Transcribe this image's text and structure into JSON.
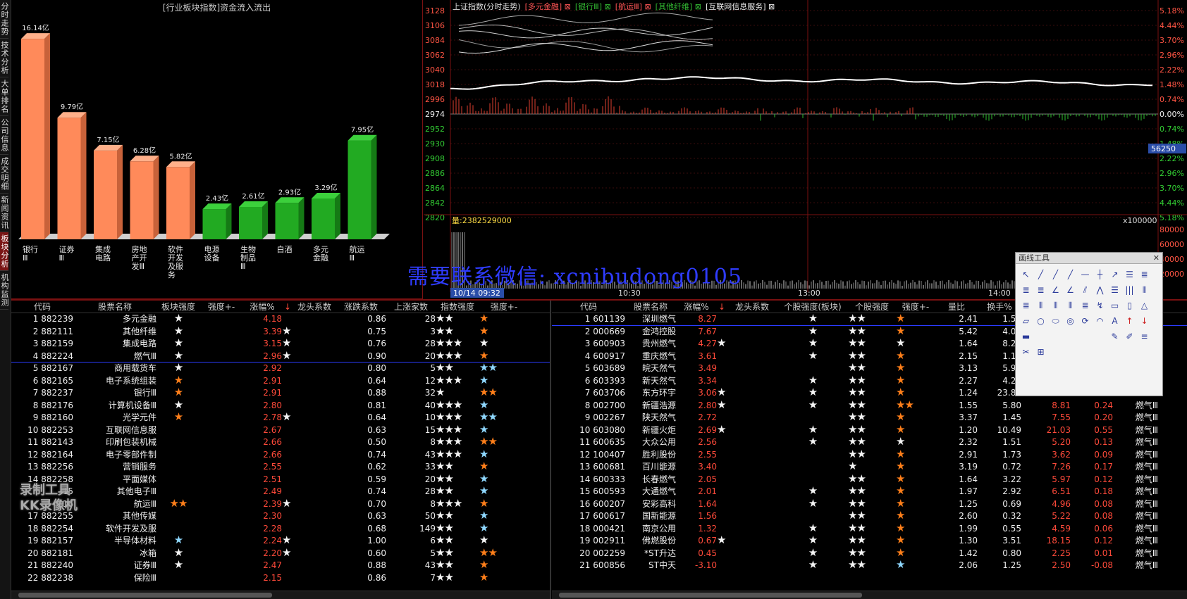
{
  "side_tabs": [
    "分时走势",
    "技术分析",
    "大单排名",
    "公司信息",
    "成交明细",
    "新闻资讯",
    "板块分析",
    "机构监测"
  ],
  "active_side_tab": 6,
  "bar_chart": {
    "title": "[行业板块指数]资金流入流出",
    "chart_data": {
      "type": "bar",
      "title": "[行业板块指数]资金流入流出",
      "categories": [
        "银行Ⅲ",
        "证券Ⅲ",
        "集成电路",
        "房地产开发Ⅲ",
        "软件开发及服务",
        "电源设备",
        "生物制品Ⅲ",
        "白酒",
        "多元金融",
        "航运Ⅲ"
      ],
      "values": [
        16.14,
        9.79,
        7.15,
        6.28,
        5.82,
        2.43,
        2.61,
        2.93,
        3.29,
        7.95
      ],
      "labels": [
        "16.14亿",
        "9.79亿",
        "7.15亿",
        "6.28亿",
        "5.82亿",
        "2.43亿",
        "2.61亿",
        "2.93亿",
        "3.29亿",
        "7.95亿"
      ],
      "colors": [
        "#ff8a5a",
        "#ff8a5a",
        "#ff8a5a",
        "#ff8a5a",
        "#ff8a5a",
        "#22aa22",
        "#22aa22",
        "#22aa22",
        "#22aa22",
        "#22aa22"
      ],
      "category_lines": [
        [
          "银行",
          "Ⅲ"
        ],
        [
          "证券",
          "Ⅲ"
        ],
        [
          "集成",
          "电路"
        ],
        [
          "房地",
          "产开",
          "发Ⅲ"
        ],
        [
          "软件",
          "开发",
          "及服",
          "务"
        ],
        [
          "电源",
          "设备"
        ],
        [
          "生物",
          "制品",
          "Ⅲ"
        ],
        [
          "白酒"
        ],
        [
          "多元",
          "金融"
        ],
        [
          "航运",
          "Ⅲ"
        ]
      ],
      "ylim": [
        0,
        17
      ]
    }
  },
  "intraday": {
    "title": "上证指数(分时走势)",
    "legend": [
      {
        "text": "上证指数(分时走势)",
        "color": "#dddddd"
      },
      {
        "text": "[多元金融] ⊠",
        "color": "#ff5555"
      },
      {
        "text": "[银行Ⅲ] ⊠",
        "color": "#33bb33"
      },
      {
        "text": "[航运Ⅲ] ⊠",
        "color": "#ff5555"
      },
      {
        "text": "[其他纤维] ⊠",
        "color": "#33bb33"
      },
      {
        "text": "[互联网信息服务] ⊠",
        "color": "#eeeeee"
      }
    ],
    "left_axis": [
      "3128",
      "3106",
      "3084",
      "3062",
      "3040",
      "3018",
      "2996",
      "2974",
      "2952",
      "2930",
      "2908",
      "2886",
      "2864",
      "2842",
      "2820"
    ],
    "right_axis": [
      "5.18%",
      "4.44%",
      "3.70%",
      "2.96%",
      "2.22%",
      "1.48%",
      "0.74%",
      "0.00%",
      "0.74%",
      "1.48%",
      "2.22%",
      "2.96%",
      "3.70%",
      "4.44%",
      "5.18%"
    ],
    "volume_label": "量:2382529000",
    "volume_scale": "x100000",
    "volume_axis": [
      "80000",
      "60000",
      "40000",
      "20000"
    ],
    "price_tag": "56250",
    "time_cursor": "10/14 09:32",
    "time_labels": [
      "10:30",
      "13:00",
      "14:00"
    ]
  },
  "watermark": "需要联系微信: xcnibudong0105",
  "left_table": {
    "headers": [
      "代码",
      "股票名称",
      "板块强度",
      "强度+-",
      "涨幅%",
      "↓",
      "龙头系数",
      "涨跌系数",
      "上涨家数",
      "指数强度",
      "强度+-"
    ],
    "rows": [
      {
        "idx": "1",
        "code": "882239",
        "name": "多元金融",
        "strength": "sw1",
        "chg": "4.18",
        "lt": "",
        "dragon": "0.86",
        "up": "28",
        "idx_s": "sw2",
        "pm": "so1"
      },
      {
        "idx": "2",
        "code": "882111",
        "name": "其他纤维",
        "strength": "sw1",
        "chg": "3.39",
        "lt": "sw1",
        "dragon": "0.75",
        "up": "3",
        "idx_s": "sw2",
        "pm": "so1"
      },
      {
        "idx": "3",
        "code": "882159",
        "name": "集成电路",
        "strength": "sw1",
        "chg": "3.15",
        "lt": "sw1",
        "dragon": "0.76",
        "up": "28",
        "idx_s": "sw3",
        "pm": "sw1"
      },
      {
        "idx": "4",
        "code": "882224",
        "name": "燃气Ⅲ",
        "strength": "sw1",
        "chg": "2.96",
        "lt": "sw1",
        "dragon": "0.90",
        "up": "20",
        "idx_s": "sw3",
        "pm": "so1"
      },
      {
        "idx": "5",
        "code": "882167",
        "name": "商用载货车",
        "strength": "sw1",
        "chg": "2.92",
        "lt": "",
        "dragon": "0.80",
        "up": "5",
        "idx_s": "sw2",
        "pm": "sb2"
      },
      {
        "idx": "6",
        "code": "882165",
        "name": "电子系统组装",
        "strength": "so1",
        "chg": "2.91",
        "lt": "",
        "dragon": "0.64",
        "up": "12",
        "idx_s": "sw3",
        "pm": "sb1"
      },
      {
        "idx": "7",
        "code": "882237",
        "name": "银行Ⅲ",
        "strength": "so1",
        "chg": "2.91",
        "lt": "",
        "dragon": "0.88",
        "up": "32",
        "idx_s": "sw1",
        "pm": "so2"
      },
      {
        "idx": "8",
        "code": "882176",
        "name": "计算机设备Ⅲ",
        "strength": "sw1",
        "chg": "2.80",
        "lt": "",
        "dragon": "0.81",
        "up": "40",
        "idx_s": "sw3",
        "pm": "sb1"
      },
      {
        "idx": "9",
        "code": "882160",
        "name": "光学元件",
        "strength": "so1",
        "chg": "2.78",
        "lt": "sw1",
        "dragon": "0.64",
        "up": "10",
        "idx_s": "sw3",
        "pm": "sb2"
      },
      {
        "idx": "10",
        "code": "882253",
        "name": "互联网信息服",
        "strength": "",
        "chg": "2.67",
        "lt": "",
        "dragon": "0.63",
        "up": "15",
        "idx_s": "sw3",
        "pm": "sb1"
      },
      {
        "idx": "11",
        "code": "882143",
        "name": "印刷包装机械",
        "strength": "",
        "chg": "2.66",
        "lt": "",
        "dragon": "0.50",
        "up": "8",
        "idx_s": "sw3",
        "pm": "so2"
      },
      {
        "idx": "12",
        "code": "882164",
        "name": "电子零部件制",
        "strength": "",
        "chg": "2.66",
        "lt": "",
        "dragon": "0.74",
        "up": "43",
        "idx_s": "sw3",
        "pm": "sb1"
      },
      {
        "idx": "13",
        "code": "882256",
        "name": "营销服务",
        "strength": "",
        "chg": "2.55",
        "lt": "",
        "dragon": "0.62",
        "up": "33",
        "idx_s": "sw2",
        "pm": "so1"
      },
      {
        "idx": "14",
        "code": "882258",
        "name": "平面媒体",
        "strength": "",
        "chg": "2.51",
        "lt": "",
        "dragon": "0.59",
        "up": "20",
        "idx_s": "sw2",
        "pm": "sb1"
      },
      {
        "idx": "15",
        "code": "",
        "name": "其他电子Ⅲ",
        "strength": "",
        "chg": "2.49",
        "lt": "",
        "dragon": "0.74",
        "up": "28",
        "idx_s": "sw2",
        "pm": "sb1"
      },
      {
        "idx": "16",
        "code": "",
        "name": "航运Ⅲ",
        "strength": "so2",
        "chg": "2.39",
        "lt": "sw1",
        "dragon": "0.70",
        "up": "8",
        "idx_s": "sw3",
        "pm": "so1"
      },
      {
        "idx": "17",
        "code": "882255",
        "name": "其他传媒",
        "strength": "",
        "chg": "2.30",
        "lt": "",
        "dragon": "0.63",
        "up": "50",
        "idx_s": "sw2",
        "pm": "sb1"
      },
      {
        "idx": "18",
        "code": "882254",
        "name": "软件开发及服",
        "strength": "",
        "chg": "2.28",
        "lt": "",
        "dragon": "0.68",
        "up": "149",
        "idx_s": "sw2",
        "pm": "sb1"
      },
      {
        "idx": "19",
        "code": "882157",
        "name": "半导体材料",
        "strength": "sb1",
        "chg": "2.24",
        "lt": "sw1",
        "dragon": "1.00",
        "up": "6",
        "idx_s": "sw2",
        "pm": "sw1"
      },
      {
        "idx": "20",
        "code": "882181",
        "name": "冰箱",
        "strength": "sw1",
        "chg": "2.20",
        "lt": "sw1",
        "dragon": "0.60",
        "up": "5",
        "idx_s": "sw2",
        "pm": "so2"
      },
      {
        "idx": "21",
        "code": "882240",
        "name": "证券Ⅲ",
        "strength": "sw1",
        "chg": "2.47",
        "lt": "",
        "dragon": "0.88",
        "up": "43",
        "idx_s": "sw2",
        "pm": "so1"
      },
      {
        "idx": "22",
        "code": "882238",
        "name": "保险Ⅲ",
        "strength": "",
        "chg": "2.15",
        "lt": "",
        "dragon": "0.86",
        "up": "7",
        "idx_s": "sw2",
        "pm": "so1"
      }
    ]
  },
  "right_table": {
    "headers": [
      "代码",
      "股票名称",
      "涨幅%",
      "↓",
      "龙头系数",
      "个股强度(板块)",
      "个股强度",
      "强度+-",
      "量比",
      "换手%",
      "最"
    ],
    "rows": [
      {
        "idx": "1",
        "code": "601139",
        "name": "深圳燃气",
        "chg": "8.27",
        "lt": "",
        "s1": "sw1",
        "s2": "sw2",
        "pm": "so1",
        "vr": "2.41",
        "to": "1.55",
        "c3": "",
        "c4": "",
        "c5": ""
      },
      {
        "idx": "2",
        "code": "000669",
        "name": "金鸿控股",
        "chg": "7.67",
        "lt": "",
        "s1": "sw1",
        "s2": "sw2",
        "pm": "so1",
        "vr": "5.42",
        "to": "4.04",
        "c3": "",
        "c4": "",
        "c5": ""
      },
      {
        "idx": "3",
        "code": "600903",
        "name": "贵州燃气",
        "chg": "4.27",
        "lt": "sw1",
        "s1": "sw1",
        "s2": "sw2",
        "pm": "sw1",
        "vr": "1.64",
        "to": "8.22",
        "c3": "",
        "c4": "",
        "c5": ""
      },
      {
        "idx": "4",
        "code": "600917",
        "name": "重庆燃气",
        "chg": "3.61",
        "lt": "",
        "s1": "sw1",
        "s2": "sw2",
        "pm": "so1",
        "vr": "2.15",
        "to": "1.19",
        "c3": "",
        "c4": "",
        "c5": ""
      },
      {
        "idx": "5",
        "code": "603689",
        "name": "皖天然气",
        "chg": "3.49",
        "lt": "",
        "s1": "",
        "s2": "sw2",
        "pm": "so1",
        "vr": "3.13",
        "to": "5.90",
        "c3": "",
        "c4": "",
        "c5": ""
      },
      {
        "idx": "6",
        "code": "603393",
        "name": "新天然气",
        "chg": "3.34",
        "lt": "",
        "s1": "sw1",
        "s2": "sw2",
        "pm": "so1",
        "vr": "2.27",
        "to": "4.20",
        "c3": "",
        "c4": "",
        "c5": ""
      },
      {
        "idx": "7",
        "code": "603706",
        "name": "东方环宇",
        "chg": "3.06",
        "lt": "sw2",
        "s1": "sw1",
        "s2": "sw2",
        "pm": "so1",
        "vr": "1.24",
        "to": "23.88",
        "c3": "",
        "c4": "",
        "c5": ""
      },
      {
        "idx": "8",
        "code": "002700",
        "name": "新疆浩源",
        "chg": "2.80",
        "lt": "sw1",
        "s1": "sw1",
        "s2": "sw2",
        "pm": "so2",
        "vr": "1.55",
        "to": "5.80",
        "c3": "8.81",
        "c4": "0.24",
        "c5": "燃气Ⅲ"
      },
      {
        "idx": "9",
        "code": "002267",
        "name": "陕天然气",
        "chg": "2.72",
        "lt": "",
        "s1": "",
        "s2": "sw2",
        "pm": "so1",
        "vr": "3.37",
        "to": "1.45",
        "c3": "7.55",
        "c4": "0.20",
        "c5": "燃气Ⅲ"
      },
      {
        "idx": "10",
        "code": "603080",
        "name": "新疆火炬",
        "chg": "2.69",
        "lt": "sw1",
        "s1": "sw1",
        "s2": "sw2",
        "pm": "so1",
        "vr": "1.20",
        "to": "10.49",
        "c3": "21.03",
        "c4": "0.55",
        "c5": "燃气Ⅲ"
      },
      {
        "idx": "11",
        "code": "600635",
        "name": "大众公用",
        "chg": "2.56",
        "lt": "",
        "s1": "sw1",
        "s2": "sw2",
        "pm": "sw1",
        "vr": "2.32",
        "to": "1.51",
        "c3": "5.20",
        "c4": "0.13",
        "c5": "燃气Ⅲ"
      },
      {
        "idx": "12",
        "code": "100407",
        "name": "胜利股份",
        "chg": "2.55",
        "lt": "",
        "s1": "",
        "s2": "sw2",
        "pm": "so1",
        "vr": "2.91",
        "to": "1.73",
        "c3": "3.62",
        "c4": "0.09",
        "c5": "燃气Ⅲ"
      },
      {
        "idx": "13",
        "code": "600681",
        "name": "百川能源",
        "chg": "3.40",
        "lt": "",
        "s1": "",
        "s2": "sw1",
        "pm": "so1",
        "vr": "3.19",
        "to": "0.72",
        "c3": "7.26",
        "c4": "0.17",
        "c5": "燃气Ⅲ"
      },
      {
        "idx": "14",
        "code": "600333",
        "name": "长春燃气",
        "chg": "2.05",
        "lt": "",
        "s1": "",
        "s2": "sw2",
        "pm": "so1",
        "vr": "1.64",
        "to": "3.22",
        "c3": "5.97",
        "c4": "0.12",
        "c5": "燃气Ⅲ"
      },
      {
        "idx": "15",
        "code": "600593",
        "name": "大通燃气",
        "chg": "2.01",
        "lt": "",
        "s1": "sw1",
        "s2": "sw2",
        "pm": "so1",
        "vr": "1.97",
        "to": "2.92",
        "c3": "6.51",
        "c4": "0.18",
        "c5": "燃气Ⅲ"
      },
      {
        "idx": "16",
        "code": "600207",
        "name": "安彩高科",
        "chg": "1.64",
        "lt": "",
        "s1": "sw1",
        "s2": "sw2",
        "pm": "so1",
        "vr": "1.25",
        "to": "0.69",
        "c3": "4.96",
        "c4": "0.08",
        "c5": "燃气Ⅲ"
      },
      {
        "idx": "17",
        "code": "600617",
        "name": "国新能源",
        "chg": "1.56",
        "lt": "",
        "s1": "",
        "s2": "sw2",
        "pm": "so1",
        "vr": "2.60",
        "to": "0.32",
        "c3": "5.22",
        "c4": "0.08",
        "c5": "燃气Ⅲ"
      },
      {
        "idx": "18",
        "code": "000421",
        "name": "南京公用",
        "chg": "1.32",
        "lt": "",
        "s1": "sw1",
        "s2": "sw2",
        "pm": "so1",
        "vr": "1.99",
        "to": "0.55",
        "c3": "4.59",
        "c4": "0.06",
        "c5": "燃气Ⅲ"
      },
      {
        "idx": "19",
        "code": "002911",
        "name": "佛燃股份",
        "chg": "0.67",
        "lt": "sw1",
        "s1": "sw1",
        "s2": "sw2",
        "pm": "so1",
        "vr": "1.30",
        "to": "3.51",
        "c3": "18.15",
        "c4": "0.12",
        "c5": "燃气Ⅲ"
      },
      {
        "idx": "20",
        "code": "002259",
        "name": "*ST升达",
        "chg": "0.45",
        "lt": "",
        "s1": "sw1",
        "s2": "sw2",
        "pm": "so1",
        "vr": "1.42",
        "to": "0.80",
        "c3": "2.25",
        "c4": "0.01",
        "c5": "燃气Ⅲ"
      },
      {
        "idx": "21",
        "code": "600856",
        "name": "ST中天",
        "chg": "-3.10",
        "lt": "",
        "s1": "sw1",
        "s2": "sw2",
        "pm": "sb1",
        "vr": "2.06",
        "to": "1.25",
        "c3": "2.50",
        "c4": "-0.08",
        "c5": "燃气Ⅲ"
      }
    ]
  },
  "toolbox": {
    "title": "画线工具",
    "close": "✕",
    "tools": [
      "↖",
      "╱",
      "╱",
      "╱",
      "—",
      "┼",
      "↗",
      "☰",
      "≣",
      "≣",
      "≣",
      "∠",
      "∠",
      "⫽",
      "⋀",
      "☰",
      "|||",
      "⦀",
      "≣",
      "⦀",
      "⦀",
      "⦀",
      "≣",
      "↯",
      "▭",
      "▯",
      "△",
      "▱",
      "○",
      "⬭",
      "◎",
      "⟳",
      "◠",
      "A",
      "↑",
      "↓",
      "▬",
      "",
      "",
      "",
      "",
      "",
      "✎",
      "✐",
      "≡",
      "✂",
      "⊞"
    ]
  },
  "kk_overlay": [
    "录制工具",
    "KK录像机"
  ]
}
